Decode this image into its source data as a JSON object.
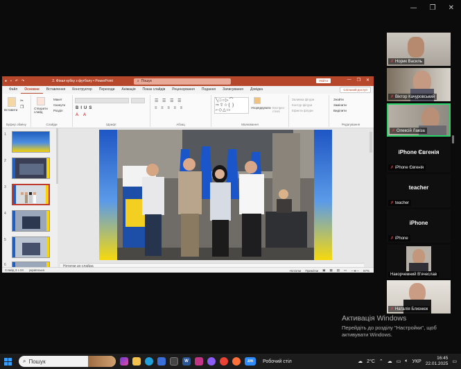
{
  "window": {
    "minimize": "—",
    "maximize": "❐",
    "close": "✕"
  },
  "powerpoint": {
    "file_title": "2. Фінал кубку з футболу • PowerPoint",
    "search_placeholder": "Пошук",
    "enter_label": "Увійти",
    "menu": [
      "Файл",
      "Основне",
      "Вставлення",
      "Конструктор",
      "Переходи",
      "Анімація",
      "Показ слайдів",
      "Рецензування",
      "Подання",
      "Записування",
      "Довідка"
    ],
    "active_menu": "Основне",
    "share_label": "Спільний доступ",
    "ribbon": {
      "paste": "Вставити",
      "clipboard": "Буфер обміну",
      "new_slide": "Створити слайд",
      "layout": "Макет",
      "reset": "Скинути",
      "section": "Розділ",
      "slides": "Слайди",
      "font": "Шрифт",
      "paragraph": "Абзац",
      "drawing": "Малювання",
      "arrange": "Упорядкувати",
      "quick_styles": "Експрес-стилі",
      "shape_fill": "Заливка фігури",
      "shape_outline": "Контур фігури",
      "shape_effects": "Ефекти фігури",
      "find": "Знайти",
      "replace": "Замінити",
      "select": "Виділити",
      "editing": "Редагування"
    },
    "slide_numbers": [
      "1",
      "2",
      "3",
      "4",
      "5",
      "6"
    ],
    "notes_placeholder": "Нотатки до слайда",
    "status": {
      "slide_count": "Слайд 3 з 24",
      "language": "українська",
      "notes": "Нотатки",
      "comments": "Примітки",
      "zoom": "67%"
    }
  },
  "participants": [
    {
      "name": "Норик Василь",
      "type": "video"
    },
    {
      "name": "Віктор Качуровський",
      "type": "video"
    },
    {
      "name": "Олексій Лакіза",
      "type": "video",
      "highlighted": true
    },
    {
      "name": "iPhone Євгенія",
      "type": "name"
    },
    {
      "name": "teacher",
      "type": "name"
    },
    {
      "name": "iPhone",
      "type": "name"
    },
    {
      "name": "Накорчемний В'ячеслав",
      "type": "video"
    },
    {
      "name": "Наталія Близнюк",
      "type": "video"
    }
  ],
  "activation": {
    "title": "Активація Windows",
    "line1": "Перейдіть до розділу \"Настройки\", щоб",
    "line2": "активувати Windows."
  },
  "taskbar": {
    "search": "Пошук",
    "desktop": "Робочий стіл",
    "weather": "2°C",
    "language": "УКР",
    "time": "16:45",
    "date": "22.01.2025"
  }
}
